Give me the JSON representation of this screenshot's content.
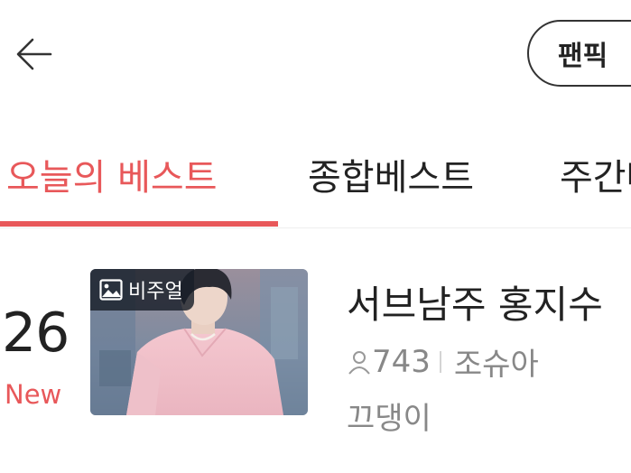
{
  "header": {
    "fanpick_label": "팬픽"
  },
  "tabs": [
    {
      "label": "오늘의 베스트",
      "active": true
    },
    {
      "label": "종합베스트",
      "active": false
    },
    {
      "label": "주간베스트",
      "active": false
    }
  ],
  "item": {
    "rank": "26",
    "rank_status": "New",
    "thumbnail_badge": "비주얼",
    "title": "서브남주 홍지수",
    "views": "743",
    "author": "조슈아",
    "subtitle": "끄댕이"
  },
  "colors": {
    "accent": "#e8585a",
    "text": "#222222",
    "muted": "#888888"
  },
  "icons": {
    "back": "arrow-left-icon",
    "person": "person-icon",
    "image": "image-icon"
  }
}
